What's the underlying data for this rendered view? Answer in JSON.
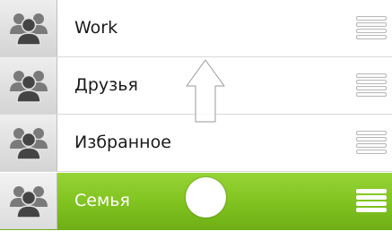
{
  "groups": [
    {
      "name": "Work",
      "selected": false
    },
    {
      "name": "Друзья",
      "selected": false
    },
    {
      "name": "Избранное",
      "selected": false
    },
    {
      "name": "Семья",
      "selected": true
    }
  ],
  "icons": {
    "avatar": "group-icon",
    "handle": "drag-handle-icon",
    "arrow": "drag-up-arrow-icon",
    "knob": "drag-knob-icon"
  },
  "colors": {
    "selected_top": "#97d437",
    "selected_bottom": "#6eae15",
    "separator": "#d9d9d9"
  }
}
